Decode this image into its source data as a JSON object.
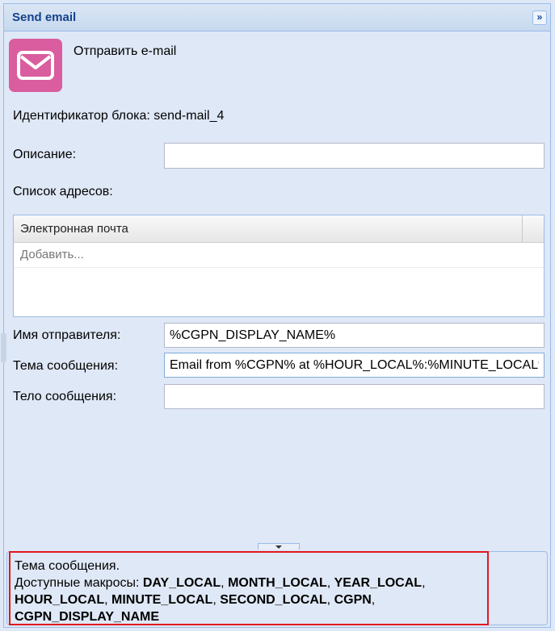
{
  "panel": {
    "title": "Send email",
    "collapse_glyph": "»"
  },
  "block": {
    "icon": "envelope-icon",
    "name": "Отправить e-mail",
    "id_text": "Идентификатор блока: send-mail_4"
  },
  "form": {
    "description_label": "Описание:",
    "description_value": "",
    "address_list_label": "Список адресов:",
    "sender_label": "Имя отправителя:",
    "sender_value": "%CGPN_DISPLAY_NAME%",
    "subject_label": "Тема сообщения:",
    "subject_value": "Email from %CGPN% at %HOUR_LOCAL%:%MINUTE_LOCAL%",
    "body_label": "Тело сообщения:",
    "body_value": ""
  },
  "grid": {
    "column_header": "Электронная почта",
    "add_placeholder": "Добавить..."
  },
  "help": {
    "title": "Тема сообщения.",
    "macros_prefix": "Доступные макросы: ",
    "macros": [
      "DAY_LOCAL",
      "MONTH_LOCAL",
      "YEAR_LOCAL",
      "HOUR_LOCAL",
      "MINUTE_LOCAL",
      "SECOND_LOCAL",
      "CGPN",
      "CGPN_DISPLAY_NAME"
    ]
  },
  "colors": {
    "icon_bg": "#d95d9f",
    "header_text": "#15428b",
    "highlight_border": "#e0181f"
  }
}
